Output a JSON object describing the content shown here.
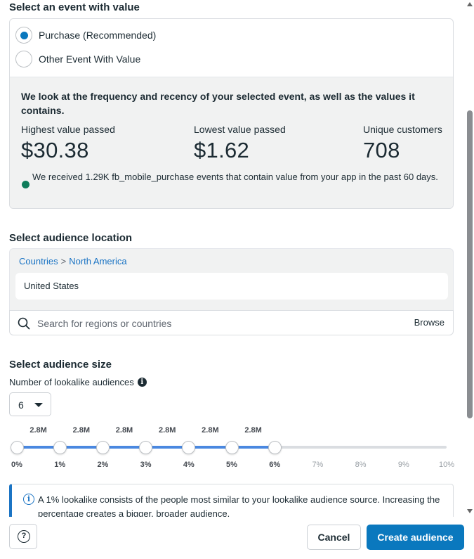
{
  "event_section": {
    "title": "Select an event with value",
    "options": [
      {
        "label": "Purchase (Recommended)",
        "selected": true
      },
      {
        "label": "Other Event With Value",
        "selected": false
      }
    ],
    "description": "We look at the frequency and recency of your selected event, as well as the values it contains.",
    "stats": [
      {
        "label": "Highest value passed",
        "value": "$30.38"
      },
      {
        "label": "Lowest value passed",
        "value": "$1.62"
      },
      {
        "label": "Unique customers",
        "value": "708"
      }
    ],
    "note": "We received 1.29K fb_mobile_purchase events that contain value from your app in the past 60 days.",
    "note_dot_color": "#0e7c5a"
  },
  "location_section": {
    "title": "Select audience location",
    "breadcrumb": [
      "Countries",
      "North America"
    ],
    "breadcrumb_separator": ">",
    "selected": "United States",
    "search_placeholder": "Search for regions or countries",
    "browse_label": "Browse"
  },
  "size_section": {
    "title": "Select audience size",
    "count_label": "Number of lookalike audiences",
    "count_value": "6",
    "slider": {
      "ticks": [
        "0%",
        "1%",
        "2%",
        "3%",
        "4%",
        "5%",
        "6%",
        "7%",
        "8%",
        "9%",
        "10%"
      ],
      "sizes": [
        "2.8M",
        "2.8M",
        "2.8M",
        "2.8M",
        "2.8M",
        "2.8M"
      ],
      "selected_max_percent": 6,
      "fill_color": "#4a88e0"
    },
    "info_text": "A 1% lookalike consists of the people most similar to your lookalike audience source. Increasing the percentage creates a bigger, broader audience."
  },
  "footer": {
    "help_symbol": "?",
    "cancel_label": "Cancel",
    "create_label": "Create audience",
    "primary_color": "#0a78be"
  }
}
